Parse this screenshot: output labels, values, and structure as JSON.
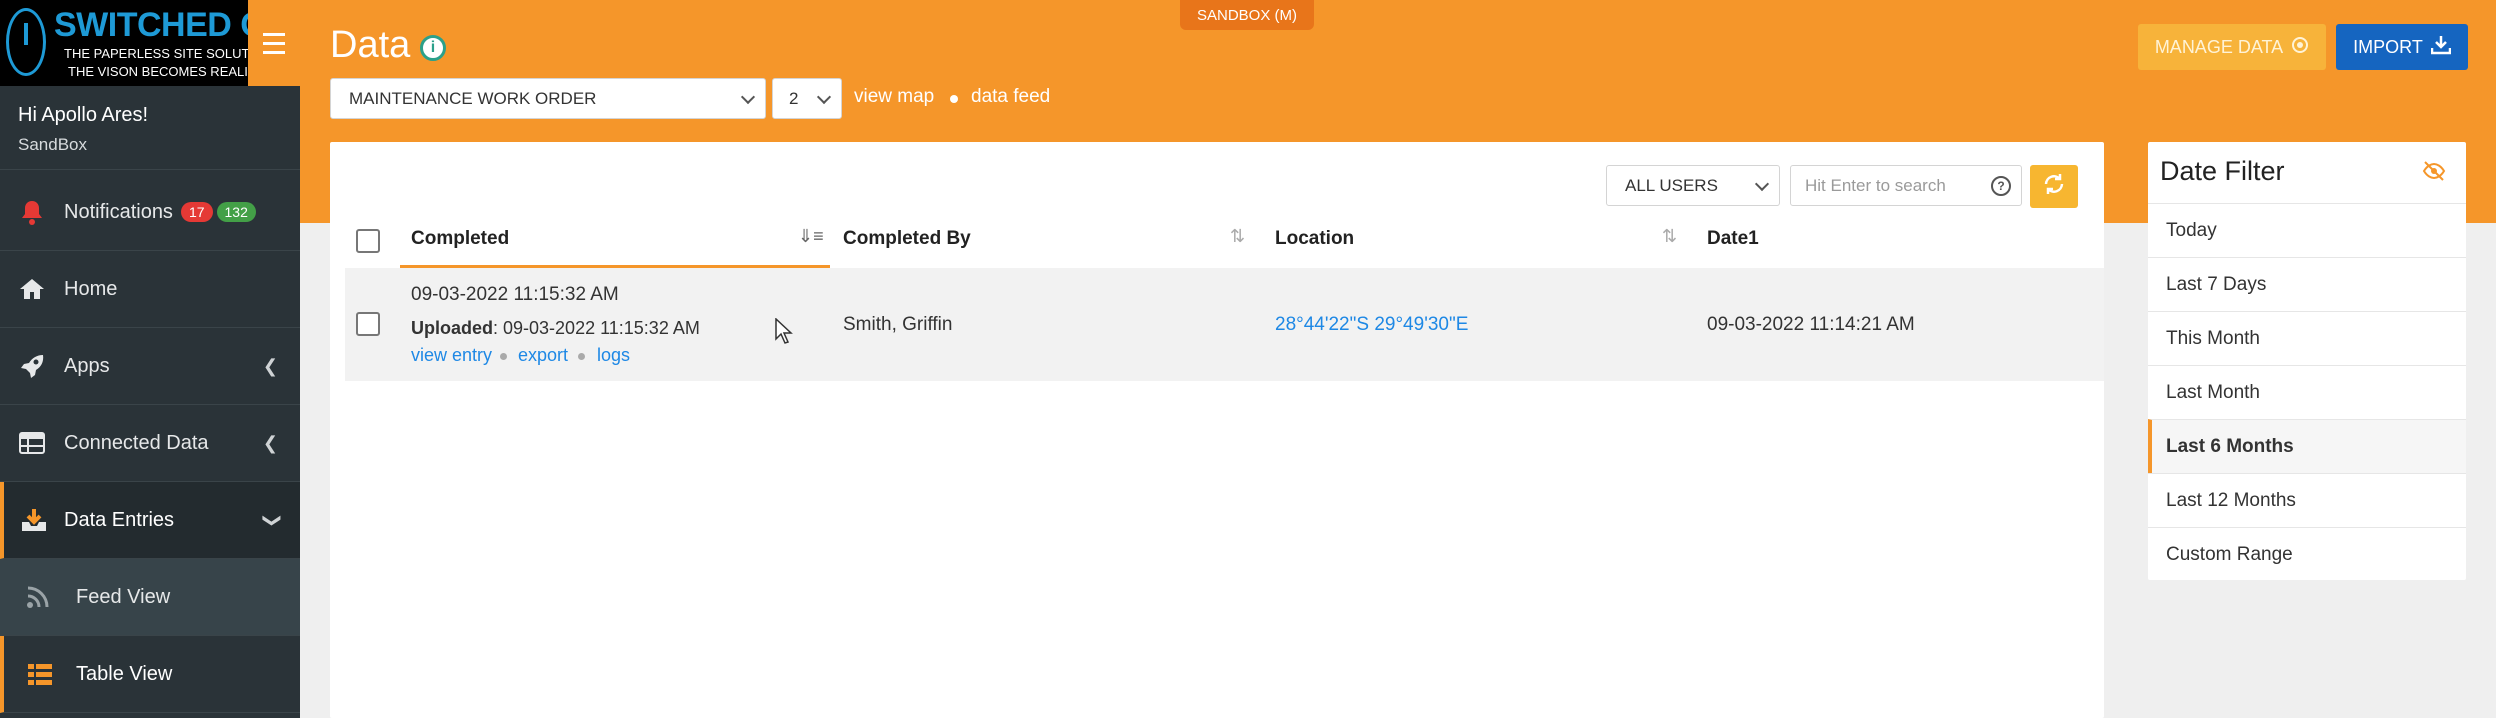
{
  "brand": {
    "title": "SWITCHED ON",
    "tagline1": "THE PAPERLESS SITE SOLUTION",
    "tagline2": "THE VISON BECOMES REALITY"
  },
  "environment_badge": "SANDBOX (M)",
  "user": {
    "greeting": "Hi Apollo Ares!",
    "org": "SandBox"
  },
  "nav": {
    "notifications": {
      "label": "Notifications",
      "badge_red": "17",
      "badge_green": "132"
    },
    "home": "Home",
    "apps": "Apps",
    "connected_data": "Connected Data",
    "data_entries": "Data Entries",
    "feed_view": "Feed View",
    "table_view": "Table View"
  },
  "header": {
    "title": "Data",
    "form_select": "MAINTENANCE WORK ORDER",
    "version_select": "2",
    "view_map": "view map",
    "data_feed": "data feed",
    "manage_data": "MANAGE DATA",
    "import": "IMPORT"
  },
  "toolbar": {
    "users_select": "ALL USERS",
    "search_placeholder": "Hit Enter to search",
    "help": "?"
  },
  "table": {
    "columns": [
      "Completed",
      "Completed By",
      "Location",
      "Date1"
    ],
    "rows": [
      {
        "completed": "09-03-2022 11:15:32 AM",
        "uploaded_label": "Uploaded",
        "uploaded_value": ": 09-03-2022 11:15:32 AM",
        "view_entry": "view entry",
        "export": "export",
        "logs": "logs",
        "completed_by": "Smith, Griffin",
        "location": "28°44'22\"S 29°49'30\"E",
        "date1": "09-03-2022 11:14:21 AM"
      }
    ]
  },
  "date_filter": {
    "title": "Date Filter",
    "options": [
      "Today",
      "Last 7 Days",
      "This Month",
      "Last Month",
      "Last 6 Months",
      "Last 12 Months",
      "Custom Range"
    ],
    "selected": "Last 6 Months"
  },
  "colors": {
    "accent": "#f5962a",
    "sidebar": "#2a3338",
    "primary": "#1565c0",
    "link": "#1e88e5"
  }
}
